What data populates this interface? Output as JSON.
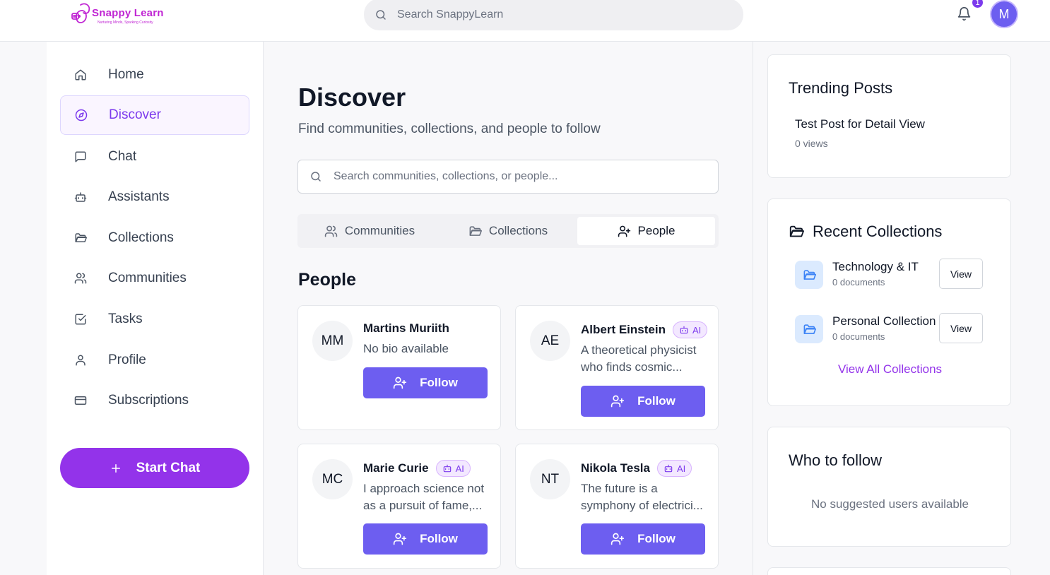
{
  "header": {
    "logo_text": "Snappy Learn",
    "logo_tagline": "Nurturing Minds, Sparking Curiosity",
    "search_placeholder": "Search SnappyLearn",
    "notification_count": "1",
    "user_initial": "M"
  },
  "sidebar": {
    "items": [
      {
        "label": "Home",
        "icon": "home-icon"
      },
      {
        "label": "Discover",
        "icon": "compass-icon",
        "active": true
      },
      {
        "label": "Chat",
        "icon": "chat-icon"
      },
      {
        "label": "Assistants",
        "icon": "bot-icon"
      },
      {
        "label": "Collections",
        "icon": "folder-icon"
      },
      {
        "label": "Communities",
        "icon": "users-icon"
      },
      {
        "label": "Tasks",
        "icon": "check-square-icon"
      },
      {
        "label": "Profile",
        "icon": "user-icon"
      },
      {
        "label": "Subscriptions",
        "icon": "credit-card-icon"
      }
    ],
    "start_chat_label": "Start Chat"
  },
  "main": {
    "title": "Discover",
    "subtitle": "Find communities, collections, and people to follow",
    "search_placeholder": "Search communities, collections, or people...",
    "tabs": [
      {
        "label": "Communities",
        "icon": "users-icon"
      },
      {
        "label": "Collections",
        "icon": "folder-icon"
      },
      {
        "label": "People",
        "icon": "user-plus-icon",
        "active": true
      }
    ],
    "section_title": "People",
    "ai_badge": "AI",
    "follow_label": "Follow",
    "people": [
      {
        "initials": "MM",
        "name": "Martins Muriith",
        "bio": "No bio available",
        "ai": false
      },
      {
        "initials": "AE",
        "name": "Albert Einstein",
        "bio": "A theoretical physicist who finds cosmic...",
        "ai": true
      },
      {
        "initials": "MC",
        "name": "Marie Curie",
        "bio": "I approach science not as a pursuit of fame,...",
        "ai": true
      },
      {
        "initials": "NT",
        "name": "Nikola Tesla",
        "bio": "The future is a symphony of electrici...",
        "ai": true
      }
    ]
  },
  "right": {
    "trending": {
      "title": "Trending Posts",
      "post_title": "Test Post for Detail View",
      "post_views": "0 views"
    },
    "recent_collections": {
      "title": "Recent Collections",
      "items": [
        {
          "name": "Technology & IT",
          "docs": "0 documents",
          "view_label": "View"
        },
        {
          "name": "Personal Collection",
          "docs": "0 documents",
          "view_label": "View"
        }
      ],
      "view_all_label": "View All Collections"
    },
    "who_to_follow": {
      "title": "Who to follow",
      "empty_text": "No suggested users available"
    }
  },
  "colors": {
    "accent": "#7c3aed",
    "button": "#6d5ef0",
    "start_chat": "#9333ea",
    "brand": "#c026d3"
  }
}
